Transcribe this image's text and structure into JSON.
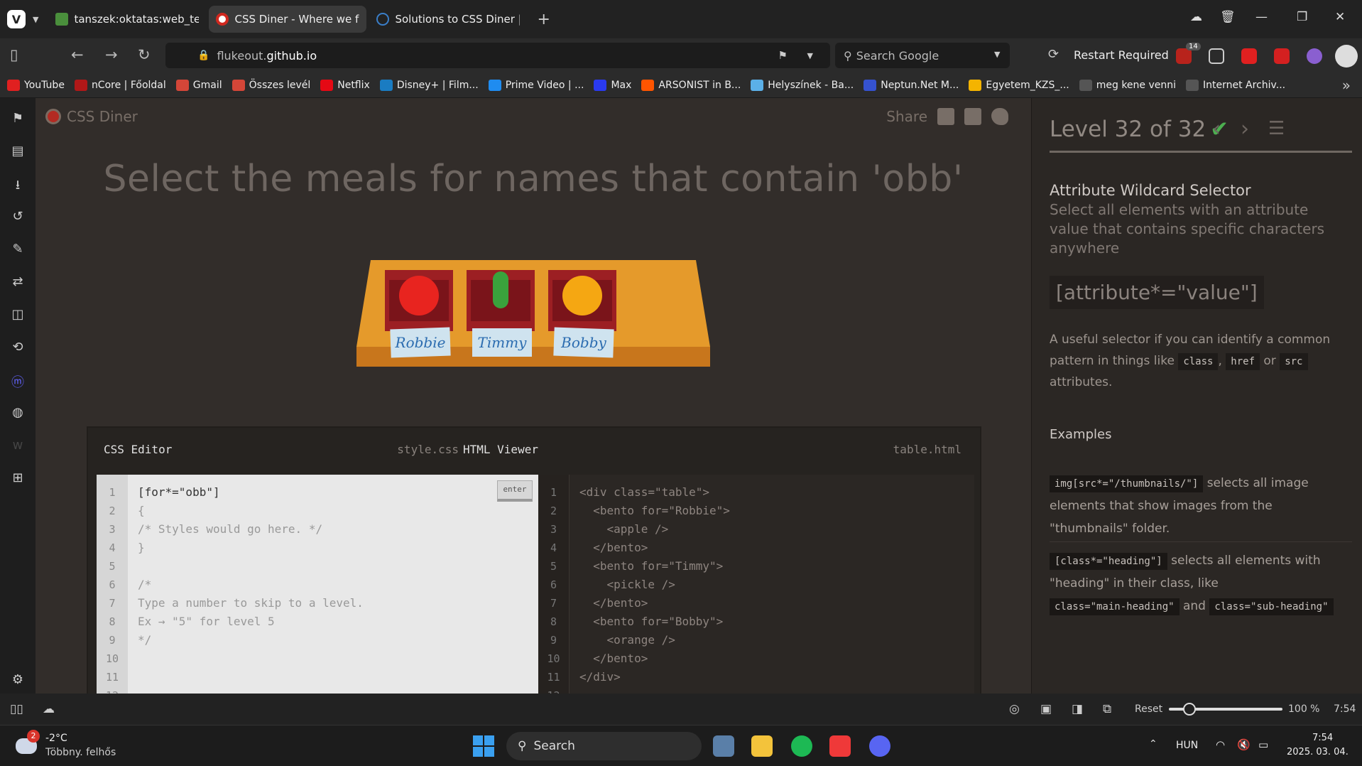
{
  "browser": {
    "tabs": [
      {
        "title": "tanszek:oktatas:web_technc",
        "active": false
      },
      {
        "title": "CSS Diner - Where we feast",
        "active": true
      },
      {
        "title": "Solutions to CSS Diner | anc",
        "active": false
      }
    ],
    "url_prefix": "flukeout.",
    "url_domain": "github.io",
    "search_placeholder": "Search Google",
    "restart_label": "Restart Required",
    "ext_badge": "14",
    "bookmarks": [
      {
        "label": "YouTube",
        "icon": "youtube-icon",
        "color": "#e02020"
      },
      {
        "label": "nCore | Főoldal",
        "icon": "ncore-icon",
        "color": "#b01818"
      },
      {
        "label": "Gmail",
        "icon": "gmail-icon",
        "color": "#d44638"
      },
      {
        "label": "Összes levél",
        "icon": "gmail-icon",
        "color": "#d44638"
      },
      {
        "label": "Netflix",
        "icon": "netflix-icon",
        "color": "#e50914"
      },
      {
        "label": "Disney+ | Film...",
        "icon": "disney-icon",
        "color": "#1a7cc2"
      },
      {
        "label": "Prime Video | ...",
        "icon": "prime-icon",
        "color": "#1f8cf0"
      },
      {
        "label": "Max",
        "icon": "max-icon",
        "color": "#2a3af0"
      },
      {
        "label": "ARSONIST in B...",
        "icon": "soundcloud-icon",
        "color": "#ff5500"
      },
      {
        "label": "Helyszínek - Ba...",
        "icon": "link-icon",
        "color": "#5bb0e8"
      },
      {
        "label": "Neptun.Net M...",
        "icon": "neptun-icon",
        "color": "#3552d0"
      },
      {
        "label": "Egyetem_KZS_...",
        "icon": "drive-icon",
        "color": "#f4b400"
      },
      {
        "label": "meg kene venni",
        "icon": "folder-icon",
        "color": "#555"
      },
      {
        "label": "Internet Archiv...",
        "icon": "archive-icon",
        "color": "#555"
      }
    ]
  },
  "game": {
    "logo": "CSS Diner",
    "share": "Share",
    "order": "Select the meals for names that contain 'obb'",
    "plates": [
      {
        "name": "Robbie",
        "item": "apple",
        "color": "#e8241f"
      },
      {
        "name": "Timmy",
        "item": "pickle",
        "color": "#3aa23c"
      },
      {
        "name": "Bobby",
        "item": "orange",
        "color": "#f5a712"
      }
    ],
    "editor": {
      "css_title": "CSS Editor",
      "css_file": "style.css",
      "html_title": "HTML Viewer",
      "html_file": "table.html",
      "enter_label": "enter",
      "typed": "[for*=\"obb\"]",
      "css_rest": "{\n/* Styles would go here. */\n}\n\n/*\nType a number to skip to a level.\nEx → \"5\" for level 5\n*/",
      "line_numbers": "1\n2\n3\n4\n5\n6\n7\n8\n9\n10\n11\n12",
      "html_code": "<div class=\"table\">\n  <bento for=\"Robbie\">\n    <apple />\n  </bento>\n  <bento for=\"Timmy\">\n    <pickle />\n  </bento>\n  <bento for=\"Bobby\">\n    <orange />\n  </bento>\n</div>"
    }
  },
  "level": {
    "label": "Level 32 of 32",
    "check": "✔",
    "progress": 1.0,
    "selector_name": "Attribute Wildcard Selector",
    "title": "Select all elements with an attribute value that contains specific characters anywhere",
    "syntax": "[attribute*=\"value\"]",
    "help_pre": "A useful selector if you can identify a common pattern in things like",
    "help_codes": [
      "class",
      "href",
      "src"
    ],
    "help_sep1": ",",
    "help_sep2": "or",
    "help_post": "attributes.",
    "examples_title": "Examples",
    "ex1_code": "img[src*=\"/thumbnails/\"]",
    "ex1_text": "selects all image elements that show images from the \"thumbnails\" folder.",
    "ex2_code": "[class*=\"heading\"]",
    "ex2_text": "selects all elements with \"heading\" in their class, like",
    "ex2_code2": "class=\"main-heading\"",
    "ex2_and": "and",
    "ex2_code3": "class=\"sub-heading\""
  },
  "statusbar": {
    "reset": "Reset",
    "zoom": "100 %",
    "time": "7:54",
    "zoom_level": 1.0
  },
  "taskbar": {
    "weather_temp": "-2°C",
    "weather_desc": "Többny. felhős",
    "weather_badge": "2",
    "search": "Search",
    "lang": "HUN",
    "time": "7:54",
    "date": "2025. 03. 04."
  }
}
